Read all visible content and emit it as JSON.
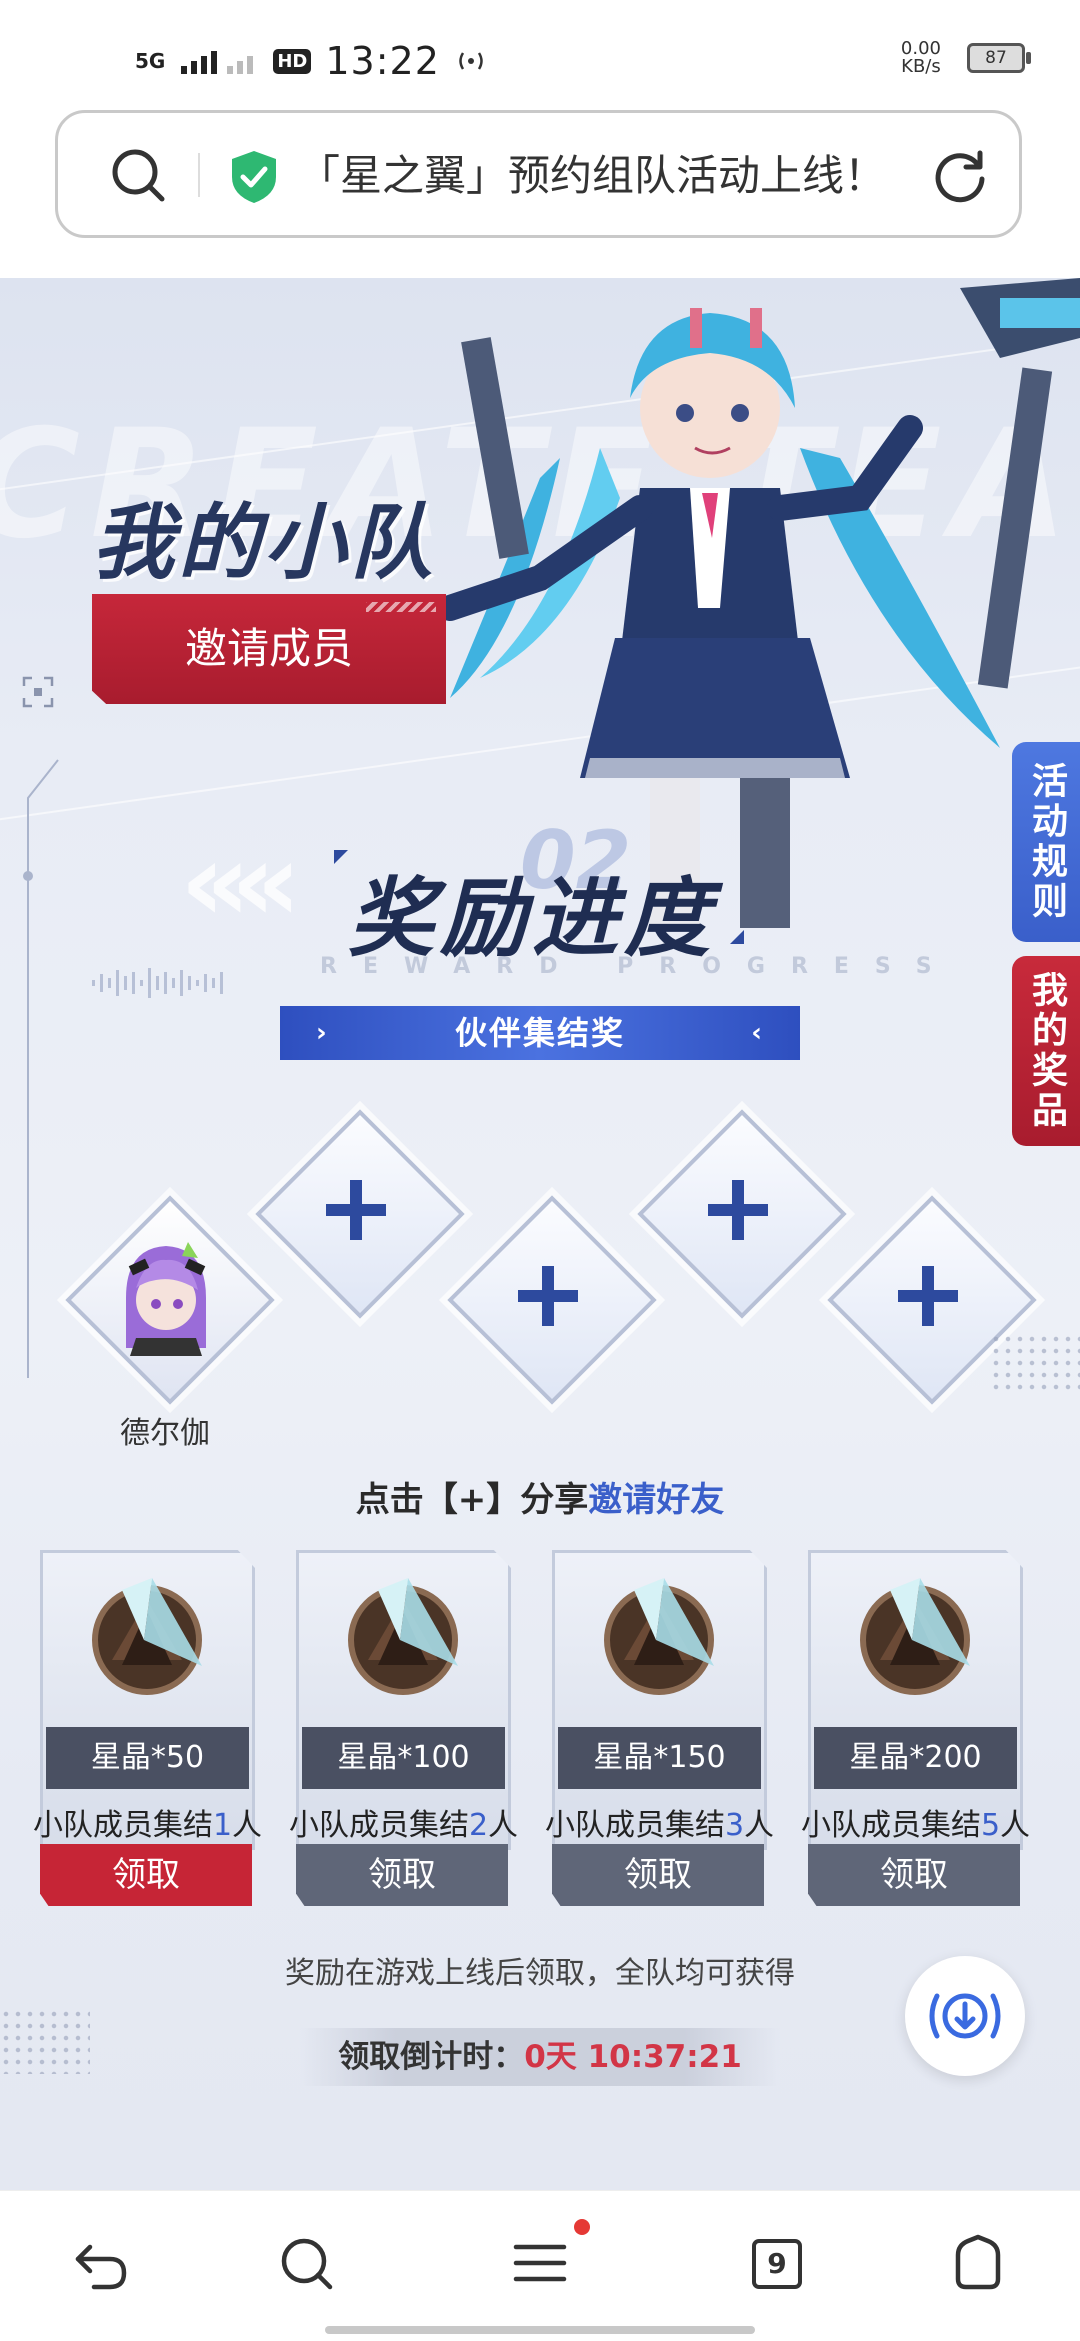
{
  "status_bar": {
    "network": "5G",
    "hd": "HD",
    "time": "13:22",
    "speed_value": "0.00",
    "speed_unit": "KB/s",
    "battery": "87"
  },
  "address_bar": {
    "title": "「星之翼」预约组队活动上线！"
  },
  "team": {
    "title": "我的小队",
    "bg_word": "CREATE TEAM",
    "invite_button": "邀请成员"
  },
  "side_tabs": {
    "rules": "活动规则",
    "prizes": "我的奖品"
  },
  "reward": {
    "title": "奖励进度",
    "subtitle_en": "REWARD PROGRESS",
    "section_number": "02",
    "bar_title": "伙伴集结奖",
    "member_name": "德尔伽",
    "share_prefix": "点击【+】分享",
    "share_link": "邀请好友"
  },
  "cards": [
    {
      "label": "星晶*50",
      "cond_prefix": "小队成员集结",
      "count": "1",
      "cond_suffix": "人",
      "claim": "领取",
      "active": true
    },
    {
      "label": "星晶*100",
      "cond_prefix": "小队成员集结",
      "count": "2",
      "cond_suffix": "人",
      "claim": "领取",
      "active": false
    },
    {
      "label": "星晶*150",
      "cond_prefix": "小队成员集结",
      "count": "3",
      "cond_suffix": "人",
      "claim": "领取",
      "active": false
    },
    {
      "label": "星晶*200",
      "cond_prefix": "小队成员集结",
      "count": "5",
      "cond_suffix": "人",
      "claim": "领取",
      "active": false
    }
  ],
  "note": "奖励在游戏上线后领取，全队均可获得",
  "countdown": {
    "label": "领取倒计时：",
    "value": "0天 10:37:21"
  },
  "bottom_nav": {
    "tabs_count": "9"
  },
  "colors": {
    "accent_red": "#c62536",
    "accent_blue": "#3a5fca",
    "navy": "#27375f"
  }
}
